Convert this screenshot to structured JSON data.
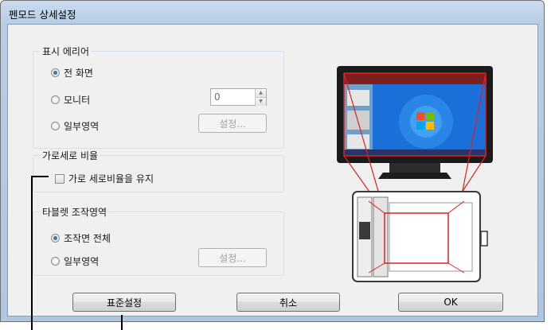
{
  "window": {
    "title": "펜모드 상세설정"
  },
  "display_area": {
    "legend": "표시 에리어",
    "options": [
      {
        "label": "전 화면",
        "selected": true
      },
      {
        "label": "모니터",
        "selected": false
      },
      {
        "label": "일부영역",
        "selected": false
      }
    ],
    "monitor_value": "0",
    "settings_button": "설정..."
  },
  "aspect": {
    "legend": "가로세로 비율",
    "checkbox_label": "가로 세로비율을 유지",
    "checked": false
  },
  "tablet_area": {
    "legend": "타블렛 조작영역",
    "options": [
      {
        "label": "조작면 전체",
        "selected": true
      },
      {
        "label": "일부영역",
        "selected": false
      }
    ],
    "settings_button": "설정..."
  },
  "buttons": {
    "defaults": "표준설정",
    "cancel": "취소",
    "ok": "OK"
  },
  "illustration": {
    "monitor_icon": "monitor-icon",
    "tablet_icon": "tablet-icon",
    "mapping_color": "#e02020",
    "screen_color": "#1a6fd8"
  }
}
